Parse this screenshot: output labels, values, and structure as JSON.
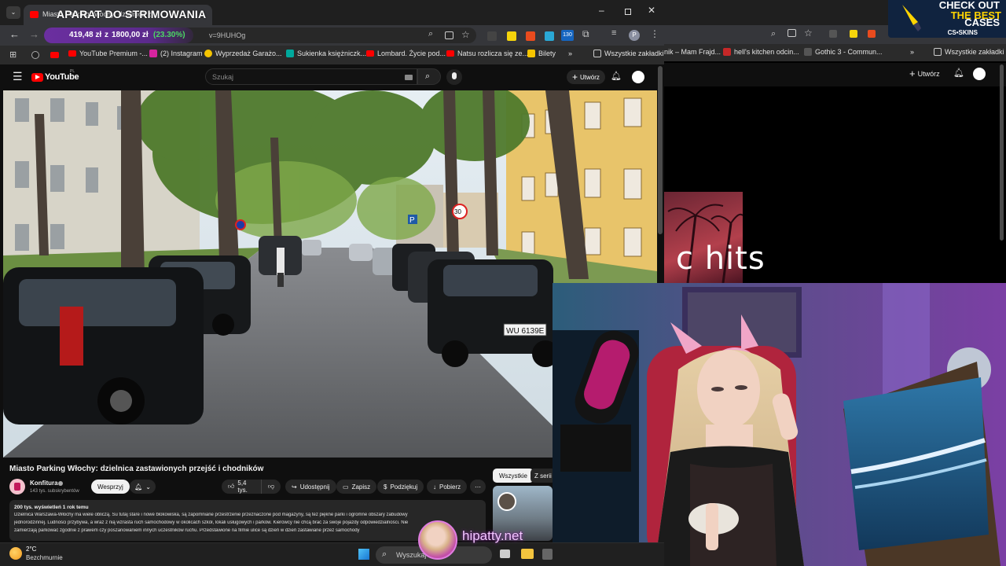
{
  "overlay": {
    "title": "APARAT DO STRIMOWANIA",
    "watermark": "hipatty.net"
  },
  "promo": {
    "line1": "CHECK OUT",
    "line2": "THE BEST",
    "line3": "CASES",
    "brand": "CS•SKINS"
  },
  "browser": {
    "tab_title": "Miasto Parking Włochy: dzielnica z...",
    "url_partial": "v=9HUHOg",
    "price_overlay": {
      "amount": "419,48 zł",
      "separator": "z",
      "target": "1800,00 zł",
      "percent": "(23.30%)"
    },
    "extension_badge": "130",
    "profile_letter": "P",
    "bookmarks": [
      {
        "label": "YouTube Premium -..."
      },
      {
        "label": "(2) Instagram"
      },
      {
        "label": "Wyprzedaż Garażo..."
      },
      {
        "label": "Sukienka księżniczk..."
      },
      {
        "label": "Lombard. Życie pod..."
      },
      {
        "label": "Natsu rozlicza się ze..."
      },
      {
        "label": "Bilety"
      }
    ],
    "all_bookmarks": "Wszystkie zakładki"
  },
  "bg_browser": {
    "bookmarks": [
      {
        "label": "nik – Mam Frajd..."
      },
      {
        "label": "hell's kitchen odcin..."
      },
      {
        "label": "Gothic 3 - Commun..."
      }
    ],
    "all_bookmarks": "Wszystkie zakładki",
    "create_label": "Utwórz",
    "hits_text": "c hits"
  },
  "youtube": {
    "logo_text": "YouTube",
    "region": "PL",
    "search_placeholder": "Szukaj",
    "create_label": "Utwórz",
    "video_title": "Miasto Parking Włochy: dzielnica zastawionych przejść i chodników",
    "channel_name": "Konfitura",
    "subscribers": "143 tys. subskrybentów",
    "support_label": "Wesprzyj",
    "likes": "5,4 tys.",
    "share_label": "Udostępnij",
    "save_label": "Zapisz",
    "thanks_label": "Podziękuj",
    "download_label": "Pobierz",
    "filter_all": "Wszystkie",
    "filter_series": "Z serii",
    "views_line": "200 tys. wyświetleń  1 rok temu",
    "desc_line1": "Dzielnica Warszawa-Włochy ma wiele obliczą. Su tutaj stare i nowe blokowiska, są zapomniane przestrzenie przeznaczone pod magazyny, są też piękne parki i ogromne obszary zabudowy",
    "desc_line2": "jednorodzinnej. Ludności przybywa, a wraz z nią wzrasta ruch samochodowy w okolicach szkół, lokali usługowych i parków. Kierowcy nie chcą brać za swoje pojazdy odpowiedzialności. Nie",
    "desc_line3": "zamierzają parkować zgodnie z prawem czy poszanowaniem innych uczestników ruchu. Przedstawione na filmie ulice są dzień w dzień zastawiane przez samochody",
    "plate": "WU 6139E",
    "speed_sign": "30",
    "parking_sign": "P"
  },
  "taskbar": {
    "temp": "2°C",
    "weather": "Bezchmurnie",
    "search_placeholder": "Wyszukaj"
  },
  "colors": {
    "percent_green": "#4cd964",
    "yt_red": "#ff0000",
    "promo_yellow": "#ffd400",
    "overlay_purple": "#8a2be2"
  }
}
